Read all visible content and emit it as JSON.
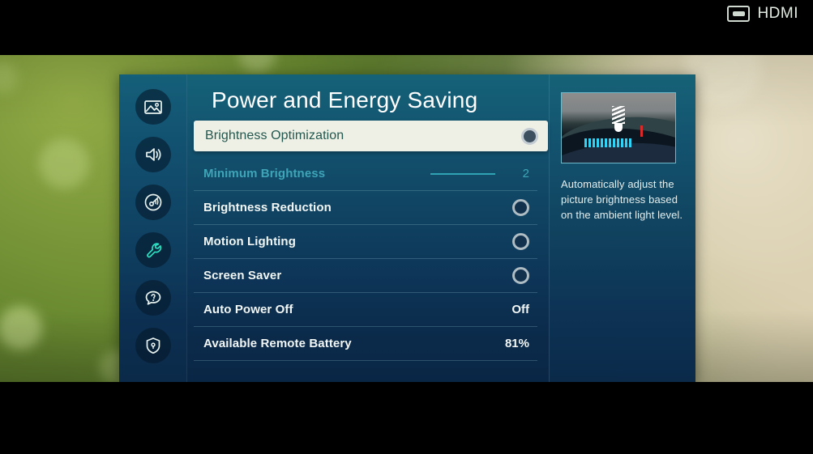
{
  "source_indicator": {
    "label": "HDMI",
    "icon": "hdmi-port-icon"
  },
  "menu": {
    "title": "Power and Energy Saving",
    "accent_color": "#2bdfc0",
    "panel_top_color": "#156277",
    "panel_bottom_color": "#0a2645",
    "highlight_bg": "#eef0e6",
    "highlight_text_color": "#22584f",
    "disabled_text_color": "#3ea5b8"
  },
  "sidebar": {
    "items": [
      {
        "icon": "picture-icon",
        "name": "picture",
        "active": false
      },
      {
        "icon": "sound-icon",
        "name": "sound",
        "active": false
      },
      {
        "icon": "broadcasting-icon",
        "name": "broadcasting",
        "active": false
      },
      {
        "icon": "wrench-icon",
        "name": "general",
        "active": true
      },
      {
        "icon": "support-question-icon",
        "name": "support",
        "active": false
      },
      {
        "icon": "shield-lock-icon",
        "name": "privacy",
        "active": false
      }
    ]
  },
  "selected_row": {
    "label": "Brightness Optimization",
    "control": "toggle",
    "toggle_state": "off"
  },
  "rows": [
    {
      "label": "Minimum Brightness",
      "value": "2",
      "control": "slider",
      "disabled": true
    },
    {
      "label": "Brightness Reduction",
      "value": "",
      "control": "toggle",
      "disabled": false
    },
    {
      "label": "Motion Lighting",
      "value": "",
      "control": "toggle",
      "disabled": false
    },
    {
      "label": "Screen Saver",
      "value": "",
      "control": "toggle",
      "disabled": false
    },
    {
      "label": "Auto Power Off",
      "value": "Off",
      "control": "text",
      "disabled": false
    },
    {
      "label": "Available Remote Battery",
      "value": "81%",
      "control": "text",
      "disabled": false
    }
  ],
  "info_panel": {
    "preview_icon": "cfl-bulb-preview",
    "description": "Automatically adjust the picture brightness based on the ambient light level."
  }
}
